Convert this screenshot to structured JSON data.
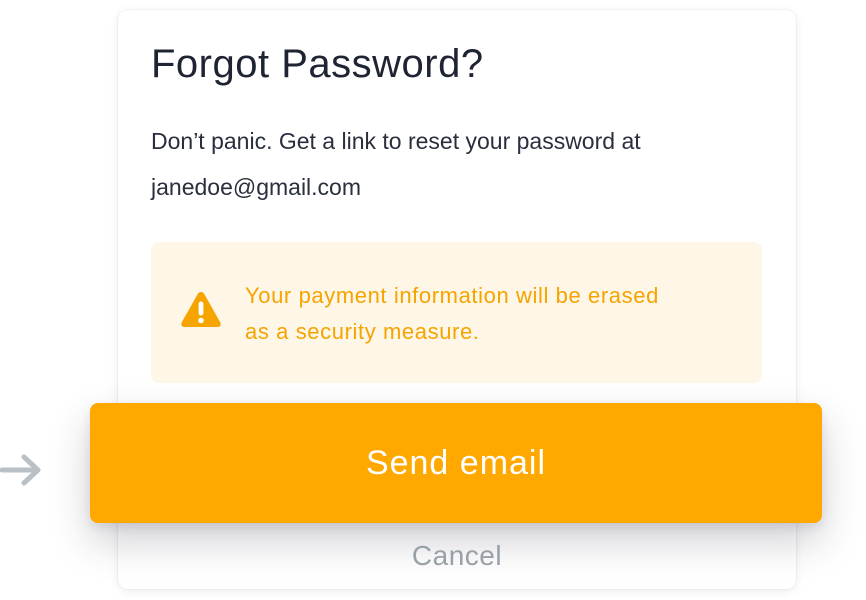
{
  "dialog": {
    "title": "Forgot Password?",
    "description": "Don’t panic. Get a link to reset your password at",
    "email": "janedoe@gmail.com"
  },
  "warning": {
    "icon": "warning-triangle-icon",
    "line1": "Your payment information will be erased",
    "line2": "as a security measure.",
    "color": "#f5a400",
    "background": "#fef6e6"
  },
  "actions": {
    "send_label": "Send email",
    "cancel_label": "Cancel",
    "accent_color": "#ffa800"
  },
  "pointer": {
    "icon": "arrow-right-icon"
  }
}
